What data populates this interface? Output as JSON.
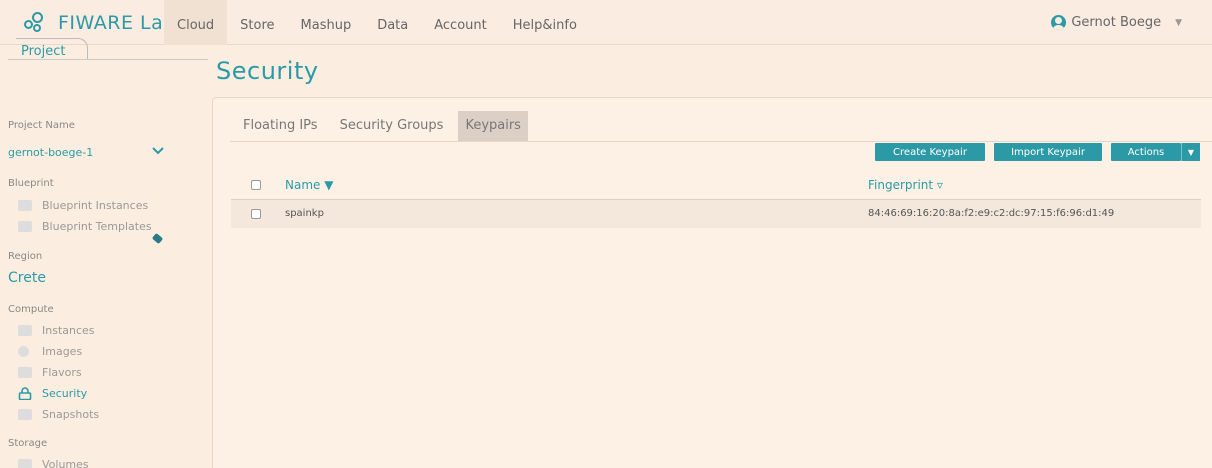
{
  "brand": {
    "logo_text": "FIWARE Lab"
  },
  "nav": {
    "items": [
      "Cloud",
      "Store",
      "Mashup",
      "Data",
      "Account",
      "Help&info"
    ],
    "active_index": 0
  },
  "user": {
    "name": "Gernot Boege",
    "caret": "▼"
  },
  "sidebar": {
    "tab_label": "Project",
    "project_name_label": "Project Name",
    "project_name_value": "gernot-boege-1",
    "blueprint_label": "Blueprint",
    "blueprint_items": [
      "Blueprint Instances",
      "Blueprint Templates"
    ],
    "region_label": "Region",
    "region_value": "Crete",
    "compute_label": "Compute",
    "compute_items": [
      "Instances",
      "Images",
      "Flavors",
      "Security",
      "Snapshots"
    ],
    "active_compute_item": "Security",
    "storage_label": "Storage",
    "storage_items": [
      "Volumes"
    ]
  },
  "page": {
    "title": "Security"
  },
  "tabs": [
    "Floating IPs",
    "Security Groups",
    "Keypairs"
  ],
  "active_tab": "Keypairs",
  "buttons": {
    "create": "Create Keypair",
    "import": "Import Keypair",
    "actions": "Actions",
    "actions_caret": "▼"
  },
  "table": {
    "columns": [
      "Name ▼",
      "Fingerprint ▿"
    ],
    "rows": [
      {
        "name": "spainkp",
        "fingerprint": "84:46:69:16:20:8a:f2:e9:c2:dc:97:15:f6:96:d1:49"
      }
    ]
  },
  "colors": {
    "accent": "#2c9aa6",
    "background": "#fbeee0"
  }
}
